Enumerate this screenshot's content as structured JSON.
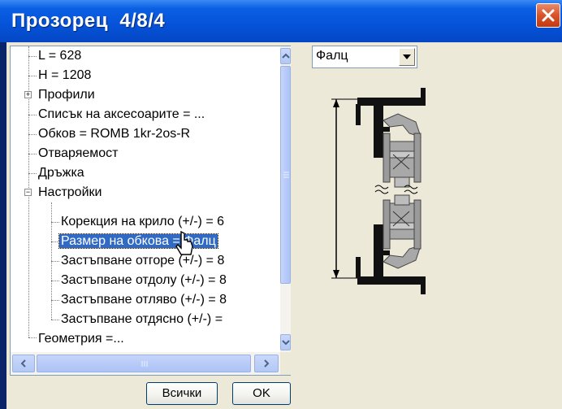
{
  "window": {
    "title": "Прозорец  4/8/4",
    "close_icon": "close-x-icon"
  },
  "tree": {
    "items": [
      {
        "label": "L = 628"
      },
      {
        "label": "H = 1208"
      },
      {
        "label": "Профили"
      },
      {
        "label": "Списък на аксесоарите =  ..."
      },
      {
        "label": "Обков =   ROMB 1kr-2os-R"
      },
      {
        "label": "Отваряемост"
      },
      {
        "label": "Дръжка"
      },
      {
        "label": "Настройки"
      },
      {
        "label": "Корекция на крило (+/-)   = 6"
      },
      {
        "label": "Размер на обкова    = Фалц"
      },
      {
        "label": "Застъпване отгоре (+/-)   = 8"
      },
      {
        "label": "Застъпване отдолу (+/-)   = 8"
      },
      {
        "label": "Застъпване отляво (+/-)   = 8"
      },
      {
        "label": "Застъпване отдясно (+/-)    ="
      },
      {
        "label": "Геометрия  =..."
      }
    ],
    "expanders": {
      "profiles": "+",
      "settings": "−"
    }
  },
  "buttons": {
    "all_label": "Всички",
    "ok_label": "OK"
  },
  "combo": {
    "selected": "Фалц"
  },
  "colors": {
    "selection": "#316ac5",
    "titlebar": "#0552d8",
    "dialog_bg": "#ece9d8"
  }
}
